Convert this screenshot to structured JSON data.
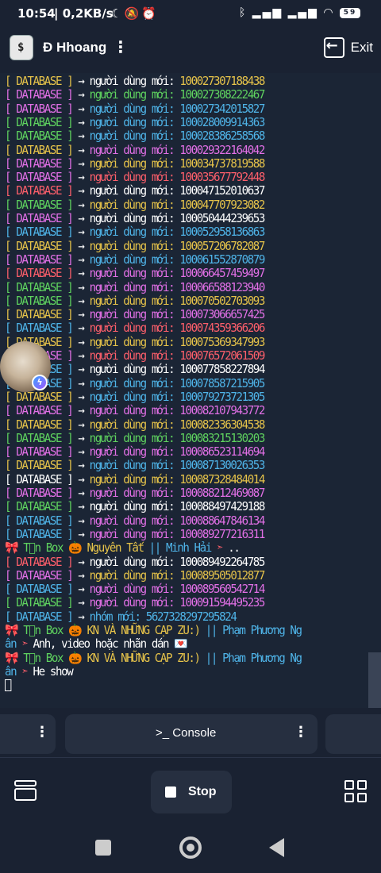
{
  "status_bar": {
    "time": "10:54",
    "speed": "| 0,2KB/s",
    "left_icons": [
      "moon-icon",
      "mute-icon",
      "alarm-icon"
    ],
    "right_icons": [
      "bluetooth-icon",
      "signal-icon",
      "signal-icon",
      "wifi-icon"
    ],
    "battery": "59"
  },
  "app_bar": {
    "title": "Đ Hhoang",
    "exit_label": "Exit"
  },
  "colors": {
    "background": "#1b2535",
    "yellow": "#e6c34a",
    "magenta": "#e270e6",
    "green": "#5fd35f",
    "cyan": "#4fb4e8",
    "red": "#ff5f6b",
    "white": "#ffffff"
  },
  "terminal": {
    "database_lines": [
      {
        "tag": "DATABASE",
        "label": "người dùng mới",
        "id": "100027307188438",
        "tag_color": "#e6c34a",
        "label_color": "#ffffff",
        "id_color": "#e6c34a"
      },
      {
        "tag": "DATABASE",
        "label": "người dùng mới",
        "id": "100027308222467",
        "tag_color": "#e270e6",
        "label_color": "#5fd35f",
        "id_color": "#5fd35f"
      },
      {
        "tag": "DATABASE",
        "label": "người dùng mới",
        "id": "100027342015827",
        "tag_color": "#e270e6",
        "label_color": "#4fb4e8",
        "id_color": "#4fb4e8"
      },
      {
        "tag": "DATABASE",
        "label": "người dùng mới",
        "id": "100028009914363",
        "tag_color": "#5fd35f",
        "label_color": "#4fb4e8",
        "id_color": "#4fb4e8"
      },
      {
        "tag": "DATABASE",
        "label": "người dùng mới",
        "id": "100028386258568",
        "tag_color": "#5fd35f",
        "label_color": "#4fb4e8",
        "id_color": "#4fb4e8"
      },
      {
        "tag": "DATABASE",
        "label": "người dùng mới",
        "id": "100029322164042",
        "tag_color": "#e6c34a",
        "label_color": "#e270e6",
        "id_color": "#e270e6"
      },
      {
        "tag": "DATABASE",
        "label": "người dùng mới",
        "id": "100034737819588",
        "tag_color": "#e270e6",
        "label_color": "#e6c34a",
        "id_color": "#e6c34a"
      },
      {
        "tag": "DATABASE",
        "label": "người dùng mới",
        "id": "100035677792448",
        "tag_color": "#e270e6",
        "label_color": "#ff5f6b",
        "id_color": "#ff5f6b"
      },
      {
        "tag": "DATABASE",
        "label": "người dùng mới",
        "id": "100047152010637",
        "tag_color": "#ff5f6b",
        "label_color": "#ffffff",
        "id_color": "#ffffff"
      },
      {
        "tag": "DATABASE",
        "label": "người dùng mới",
        "id": "100047707923082",
        "tag_color": "#5fd35f",
        "label_color": "#e6c34a",
        "id_color": "#e6c34a"
      },
      {
        "tag": "DATABASE",
        "label": "người dùng mới",
        "id": "100050444239653",
        "tag_color": "#e270e6",
        "label_color": "#ffffff",
        "id_color": "#ffffff"
      },
      {
        "tag": "DATABASE",
        "label": "người dùng mới",
        "id": "100052958136863",
        "tag_color": "#4fb4e8",
        "label_color": "#4fb4e8",
        "id_color": "#4fb4e8"
      },
      {
        "tag": "DATABASE",
        "label": "người dùng mới",
        "id": "100057206782087",
        "tag_color": "#e6c34a",
        "label_color": "#e6c34a",
        "id_color": "#e6c34a"
      },
      {
        "tag": "DATABASE",
        "label": "người dùng mới",
        "id": "100061552870879",
        "tag_color": "#e270e6",
        "label_color": "#4fb4e8",
        "id_color": "#4fb4e8"
      },
      {
        "tag": "DATABASE",
        "label": "người dùng mới",
        "id": "100066457459497",
        "tag_color": "#ff5f6b",
        "label_color": "#e270e6",
        "id_color": "#e270e6"
      },
      {
        "tag": "DATABASE",
        "label": "người dùng mới",
        "id": "100066588123940",
        "tag_color": "#5fd35f",
        "label_color": "#e270e6",
        "id_color": "#e270e6"
      },
      {
        "tag": "DATABASE",
        "label": "người dùng mới",
        "id": "100070502703093",
        "tag_color": "#5fd35f",
        "label_color": "#e6c34a",
        "id_color": "#e6c34a"
      },
      {
        "tag": "DATABASE",
        "label": "người dùng mới",
        "id": "100073066657425",
        "tag_color": "#e6c34a",
        "label_color": "#e270e6",
        "id_color": "#e270e6"
      },
      {
        "tag": "DATABASE",
        "label": "người dùng mới",
        "id": "100074359366206",
        "tag_color": "#4fb4e8",
        "label_color": "#ff5f6b",
        "id_color": "#ff5f6b"
      },
      {
        "tag": "DATABASE",
        "label": "người dùng mới",
        "id": "100075369347993",
        "tag_color": "#e6c34a",
        "label_color": "#e6c34a",
        "id_color": "#e6c34a"
      },
      {
        "tag": "DATABASE",
        "label": "người dùng mới",
        "id": "100076572061509",
        "tag_color": "#e270e6",
        "label_color": "#ff5f6b",
        "id_color": "#ff5f6b"
      },
      {
        "tag": "DATABASE",
        "label": "người dùng mới",
        "id": "100077858227894",
        "tag_color": "#4fb4e8",
        "label_color": "#ffffff",
        "id_color": "#ffffff"
      },
      {
        "tag": "DATABASE",
        "label": "người dùng mới",
        "id": "100078587215905",
        "tag_color": "#4fb4e8",
        "label_color": "#4fb4e8",
        "id_color": "#4fb4e8"
      },
      {
        "tag": "DATABASE",
        "label": "người dùng mới",
        "id": "100079273721305",
        "tag_color": "#e6c34a",
        "label_color": "#4fb4e8",
        "id_color": "#4fb4e8"
      },
      {
        "tag": "DATABASE",
        "label": "người dùng mới",
        "id": "100082107943772",
        "tag_color": "#e270e6",
        "label_color": "#e270e6",
        "id_color": "#e270e6"
      },
      {
        "tag": "DATABASE",
        "label": "người dùng mới",
        "id": "100082336304538",
        "tag_color": "#e6c34a",
        "label_color": "#e6c34a",
        "id_color": "#e6c34a"
      },
      {
        "tag": "DATABASE",
        "label": "người dùng mới",
        "id": "100083215130203",
        "tag_color": "#5fd35f",
        "label_color": "#5fd35f",
        "id_color": "#5fd35f"
      },
      {
        "tag": "DATABASE",
        "label": "người dùng mới",
        "id": "100086523114694",
        "tag_color": "#e270e6",
        "label_color": "#e270e6",
        "id_color": "#e270e6"
      },
      {
        "tag": "DATABASE",
        "label": "người dùng mới",
        "id": "100087130026353",
        "tag_color": "#e6c34a",
        "label_color": "#4fb4e8",
        "id_color": "#4fb4e8"
      },
      {
        "tag": "DATABASE",
        "label": "người dùng mới",
        "id": "100087328484014",
        "tag_color": "#ffffff",
        "label_color": "#e6c34a",
        "id_color": "#e6c34a"
      },
      {
        "tag": "DATABASE",
        "label": "người dùng mới",
        "id": "100088212469087",
        "tag_color": "#e270e6",
        "label_color": "#e270e6",
        "id_color": "#e270e6"
      },
      {
        "tag": "DATABASE",
        "label": "người dùng mới",
        "id": "100088497429188",
        "tag_color": "#5fd35f",
        "label_color": "#ffffff",
        "id_color": "#ffffff"
      },
      {
        "tag": "DATABASE",
        "label": "người dùng mới",
        "id": "100088647846134",
        "tag_color": "#4fb4e8",
        "label_color": "#e270e6",
        "id_color": "#e270e6"
      },
      {
        "tag": "DATABASE",
        "label": "người dùng mới",
        "id": "100089277216311",
        "tag_color": "#4fb4e8",
        "label_color": "#e270e6",
        "id_color": "#e270e6"
      }
    ],
    "msg1": {
      "prefix": "🎀 T󰀀n Box 🎃",
      "group": "Nguyên Tất",
      "sep": "||",
      "user": "Minh Hải",
      "arrow": "➣",
      "text": ".."
    },
    "database_lines_2": [
      {
        "tag": "DATABASE",
        "label": "người dùng mới",
        "id": "100089492264785",
        "tag_color": "#ff5f6b",
        "label_color": "#ffffff",
        "id_color": "#ffffff"
      },
      {
        "tag": "DATABASE",
        "label": "người dùng mới",
        "id": "100089505012877",
        "tag_color": "#e270e6",
        "label_color": "#e6c34a",
        "id_color": "#e6c34a"
      },
      {
        "tag": "DATABASE",
        "label": "người dùng mới",
        "id": "100089560542714",
        "tag_color": "#4fb4e8",
        "label_color": "#e270e6",
        "id_color": "#e270e6"
      },
      {
        "tag": "DATABASE",
        "label": "người dùng mới",
        "id": "100091594495235",
        "tag_color": "#5fd35f",
        "label_color": "#e270e6",
        "id_color": "#e270e6"
      },
      {
        "tag": "DATABASE",
        "label": "nhóm mới",
        "id": "5627328297295824",
        "tag_color": "#4fb4e8",
        "label_color": "#4fb4e8",
        "id_color": "#4fb4e8"
      }
    ],
    "msg2": {
      "prefix": "🎀 T󰀀n Box 🎃",
      "group": "KN VÀ NHỮNG CẠP ZU:)",
      "sep": "||",
      "user": "Phạm Phương Ng",
      "user_cont": "ân",
      "arrow": "➣",
      "text": "Anh, video hoặc nhãn dán 💌"
    },
    "msg3": {
      "prefix": "🎀 T󰀀n Box 🎃",
      "group": "KN VÀ NHỮNG CẠP ZU:)",
      "sep": "||",
      "user": "Phạm Phương Ng",
      "user_cont": "ân",
      "arrow": "➣",
      "text": "He show"
    }
  },
  "tabs": {
    "console_label": ">_  Console"
  },
  "bottom_bar": {
    "stop_label": "Stop"
  }
}
